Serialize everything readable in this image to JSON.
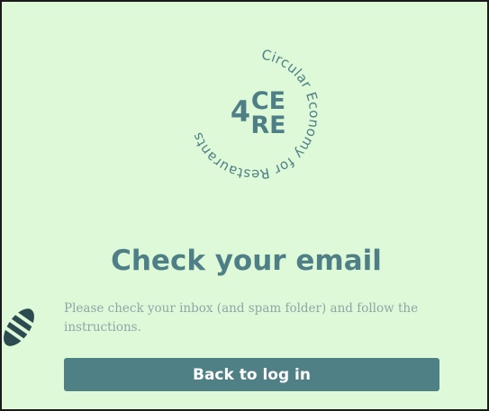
{
  "logo": {
    "ring_text": "Circular Economy for Restaurants",
    "line1": "CE",
    "line2": "RE",
    "mark": "4",
    "color": "#4f7f86"
  },
  "page": {
    "heading": "Check your email",
    "message": "Please check your inbox (and spam folder) and follow the instructions."
  },
  "actions": {
    "back_label": "Back to log in"
  },
  "side_mark": {
    "icon": "striped-leaf-icon"
  },
  "colors": {
    "background": "#ddf9d8",
    "accent": "#4e8086",
    "muted_text": "#8ea6a7",
    "button_text": "#ffffff"
  }
}
